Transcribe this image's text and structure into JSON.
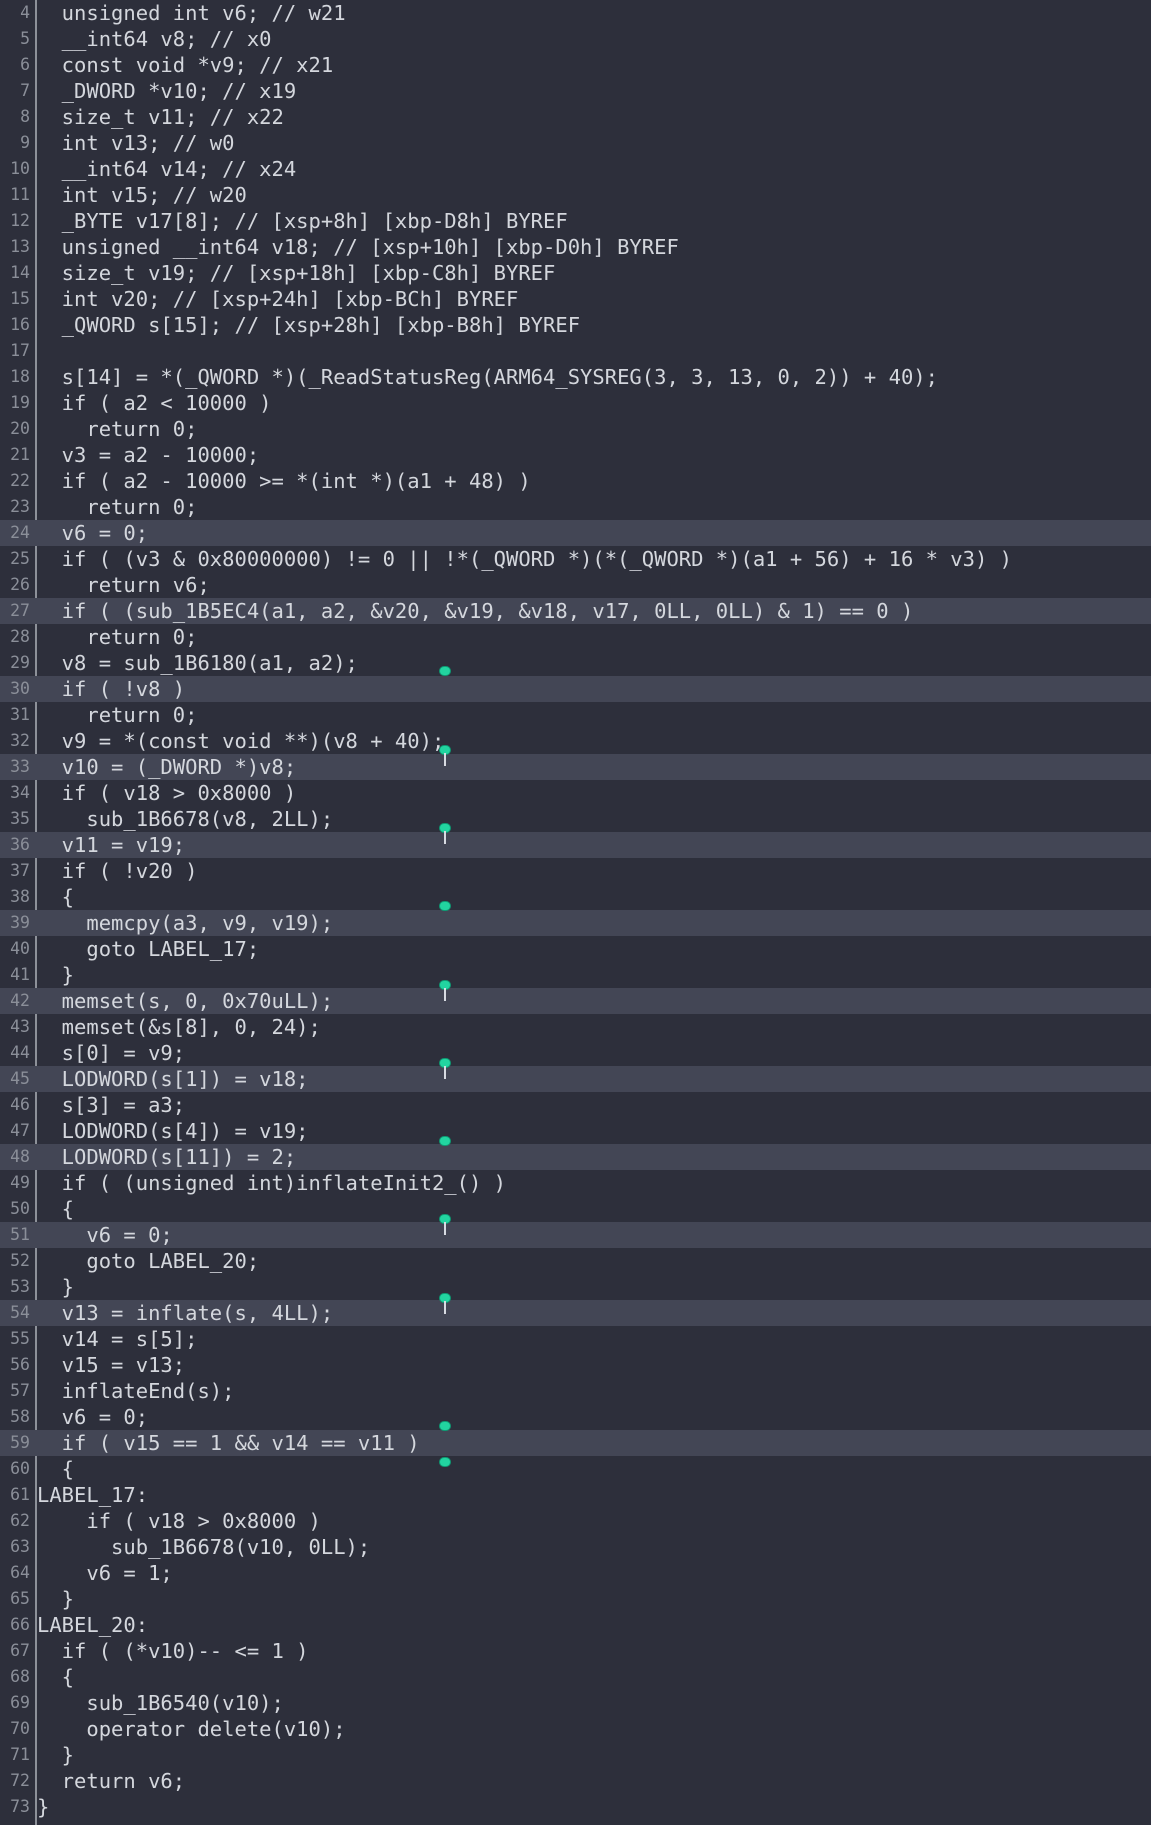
{
  "editor": {
    "lines": [
      {
        "n": "4",
        "text": "  unsigned int v6; // w21",
        "hl": false
      },
      {
        "n": "5",
        "text": "  __int64 v8; // x0",
        "hl": false
      },
      {
        "n": "6",
        "text": "  const void *v9; // x21",
        "hl": false
      },
      {
        "n": "7",
        "text": "  _DWORD *v10; // x19",
        "hl": false
      },
      {
        "n": "8",
        "text": "  size_t v11; // x22",
        "hl": false
      },
      {
        "n": "9",
        "text": "  int v13; // w0",
        "hl": false
      },
      {
        "n": "10",
        "text": "  __int64 v14; // x24",
        "hl": false
      },
      {
        "n": "11",
        "text": "  int v15; // w20",
        "hl": false
      },
      {
        "n": "12",
        "text": "  _BYTE v17[8]; // [xsp+8h] [xbp-D8h] BYREF",
        "hl": false
      },
      {
        "n": "13",
        "text": "  unsigned __int64 v18; // [xsp+10h] [xbp-D0h] BYREF",
        "hl": false
      },
      {
        "n": "14",
        "text": "  size_t v19; // [xsp+18h] [xbp-C8h] BYREF",
        "hl": false
      },
      {
        "n": "15",
        "text": "  int v20; // [xsp+24h] [xbp-BCh] BYREF",
        "hl": false
      },
      {
        "n": "16",
        "text": "  _QWORD s[15]; // [xsp+28h] [xbp-B8h] BYREF",
        "hl": false
      },
      {
        "n": "17",
        "text": "",
        "hl": false
      },
      {
        "n": "18",
        "text": "  s[14] = *(_QWORD *)(_ReadStatusReg(ARM64_SYSREG(3, 3, 13, 0, 2)) + 40);",
        "hl": false
      },
      {
        "n": "19",
        "text": "  if ( a2 < 10000 )",
        "hl": false
      },
      {
        "n": "20",
        "text": "    return 0;",
        "hl": false
      },
      {
        "n": "21",
        "text": "  v3 = a2 - 10000;",
        "hl": false
      },
      {
        "n": "22",
        "text": "  if ( a2 - 10000 >= *(int *)(a1 + 48) )",
        "hl": false
      },
      {
        "n": "23",
        "text": "    return 0;",
        "hl": false
      },
      {
        "n": "24",
        "text": "  v6 = 0;",
        "hl": true
      },
      {
        "n": "25",
        "text": "  if ( (v3 & 0x80000000) != 0 || !*(_QWORD *)(*(_QWORD *)(a1 + 56) + 16 * v3) )",
        "hl": false
      },
      {
        "n": "26",
        "text": "    return v6;",
        "hl": false
      },
      {
        "n": "27",
        "text": "  if ( (sub_1B5EC4(a1, a2, &v20, &v19, &v18, v17, 0LL, 0LL) & 1) == 0 )",
        "hl": true
      },
      {
        "n": "28",
        "text": "    return 0;",
        "hl": false
      },
      {
        "n": "29",
        "text": "  v8 = sub_1B6180(a1, a2);",
        "hl": false
      },
      {
        "n": "30",
        "text": "  if ( !v8 )",
        "hl": true
      },
      {
        "n": "31",
        "text": "    return 0;",
        "hl": false
      },
      {
        "n": "32",
        "text": "  v9 = *(const void **)(v8 + 40);",
        "hl": false
      },
      {
        "n": "33",
        "text": "  v10 = (_DWORD *)v8;",
        "hl": true
      },
      {
        "n": "34",
        "text": "  if ( v18 > 0x8000 )",
        "hl": false
      },
      {
        "n": "35",
        "text": "    sub_1B6678(v8, 2LL);",
        "hl": false
      },
      {
        "n": "36",
        "text": "  v11 = v19;",
        "hl": true
      },
      {
        "n": "37",
        "text": "  if ( !v20 )",
        "hl": false
      },
      {
        "n": "38",
        "text": "  {",
        "hl": false
      },
      {
        "n": "39",
        "text": "    memcpy(a3, v9, v19);",
        "hl": true
      },
      {
        "n": "40",
        "text": "    goto LABEL_17;",
        "hl": false
      },
      {
        "n": "41",
        "text": "  }",
        "hl": false
      },
      {
        "n": "42",
        "text": "  memset(s, 0, 0x70uLL);",
        "hl": true
      },
      {
        "n": "43",
        "text": "  memset(&s[8], 0, 24);",
        "hl": false
      },
      {
        "n": "44",
        "text": "  s[0] = v9;",
        "hl": false
      },
      {
        "n": "45",
        "text": "  LODWORD(s[1]) = v18;",
        "hl": true
      },
      {
        "n": "46",
        "text": "  s[3] = a3;",
        "hl": false
      },
      {
        "n": "47",
        "text": "  LODWORD(s[4]) = v19;",
        "hl": false
      },
      {
        "n": "48",
        "text": "  LODWORD(s[11]) = 2;",
        "hl": true
      },
      {
        "n": "49",
        "text": "  if ( (unsigned int)inflateInit2_() )",
        "hl": false
      },
      {
        "n": "50",
        "text": "  {",
        "hl": false
      },
      {
        "n": "51",
        "text": "    v6 = 0;",
        "hl": true
      },
      {
        "n": "52",
        "text": "    goto LABEL_20;",
        "hl": false
      },
      {
        "n": "53",
        "text": "  }",
        "hl": false
      },
      {
        "n": "54",
        "text": "  v13 = inflate(s, 4LL);",
        "hl": true
      },
      {
        "n": "55",
        "text": "  v14 = s[5];",
        "hl": false
      },
      {
        "n": "56",
        "text": "  v15 = v13;",
        "hl": false
      },
      {
        "n": "57",
        "text": "  inflateEnd(s);",
        "hl": false
      },
      {
        "n": "58",
        "text": "  v6 = 0;",
        "hl": false
      },
      {
        "n": "59",
        "text": "  if ( v15 == 1 && v14 == v11 )",
        "hl": true
      },
      {
        "n": "60",
        "text": "  {",
        "hl": false
      },
      {
        "n": "61",
        "text": "LABEL_17:",
        "hl": false
      },
      {
        "n": "62",
        "text": "    if ( v18 > 0x8000 )",
        "hl": false
      },
      {
        "n": "63",
        "text": "      sub_1B6678(v10, 0LL);",
        "hl": false
      },
      {
        "n": "64",
        "text": "    v6 = 1;",
        "hl": false
      },
      {
        "n": "65",
        "text": "  }",
        "hl": false
      },
      {
        "n": "66",
        "text": "LABEL_20:",
        "hl": false
      },
      {
        "n": "67",
        "text": "  if ( (*v10)-- <= 1 )",
        "hl": false
      },
      {
        "n": "68",
        "text": "  {",
        "hl": false
      },
      {
        "n": "69",
        "text": "    sub_1B6540(v10);",
        "hl": false
      },
      {
        "n": "70",
        "text": "    operator delete(v10);",
        "hl": false
      },
      {
        "n": "71",
        "text": "  }",
        "hl": false
      },
      {
        "n": "72",
        "text": "  return v6;",
        "hl": false
      },
      {
        "n": "73",
        "text": "}",
        "hl": false
      }
    ]
  },
  "colors": {
    "background": "#2d2f3b",
    "highlight_row": "#434655",
    "line_number": "#8b8f99",
    "text": "#d4d7dd",
    "variable": "#f0a070",
    "type": "#7fb2f0",
    "marker": "#22d4a0"
  },
  "icons": {
    "breakpoint_marker": "marker-pin-icon"
  }
}
